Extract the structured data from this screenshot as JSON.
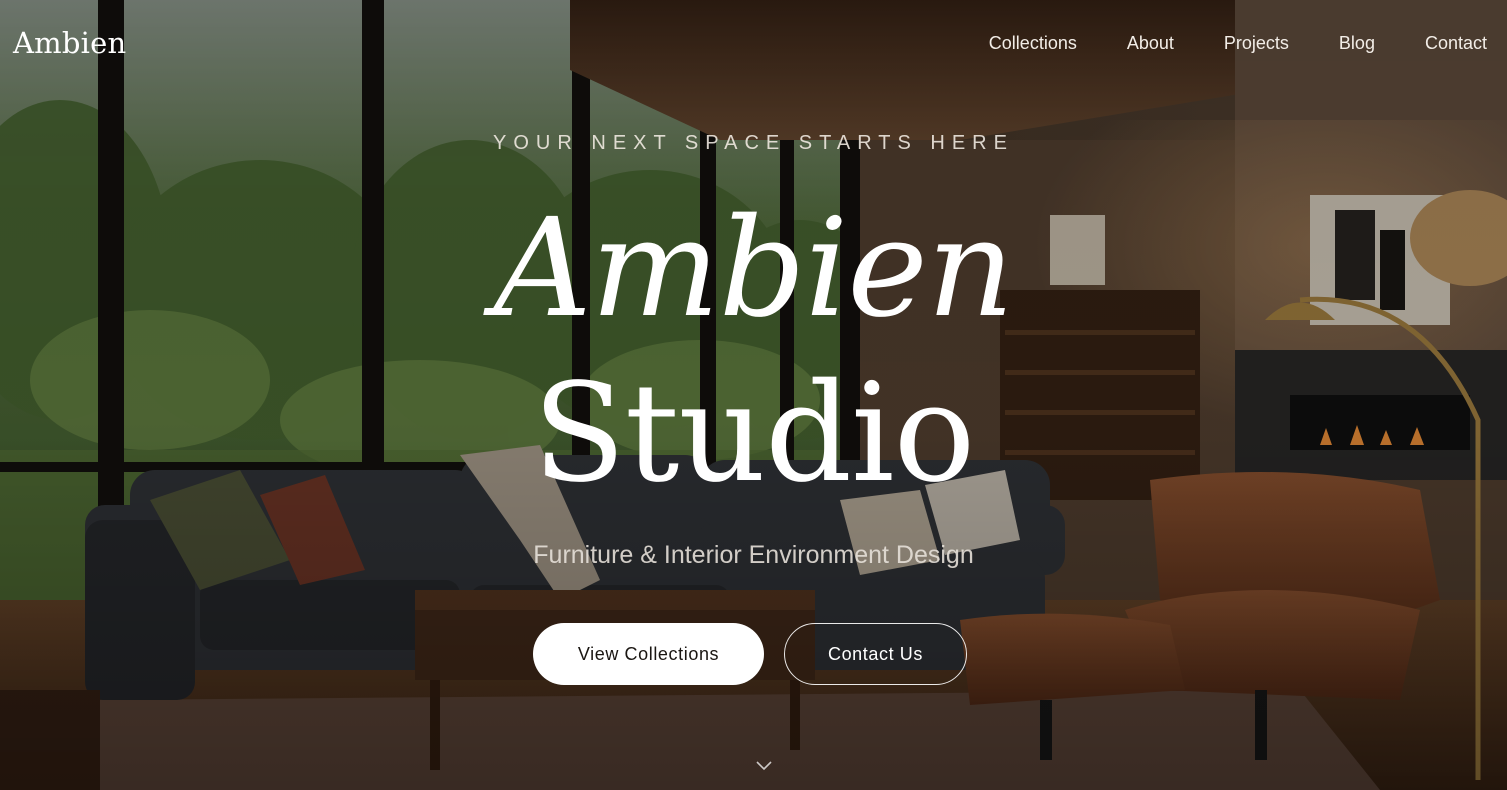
{
  "nav": {
    "logo": "Ambien",
    "links": [
      "Collections",
      "About",
      "Projects",
      "Blog",
      "Contact"
    ]
  },
  "hero": {
    "eyebrow": "YOUR NEXT SPACE STARTS HERE",
    "title_line1": "Ambien",
    "title_line2": "Studio",
    "subtitle": "Furniture & Interior Environment Design",
    "primary_cta": "View Collections",
    "secondary_cta": "Contact Us",
    "scroll_icon": "chevron-down-icon",
    "background_image": "living-room-interior-photo"
  },
  "colors": {
    "text": "#ffffff",
    "primary_button_bg": "#ffffff",
    "primary_button_text": "#1a1612",
    "overlay": "#000000"
  }
}
